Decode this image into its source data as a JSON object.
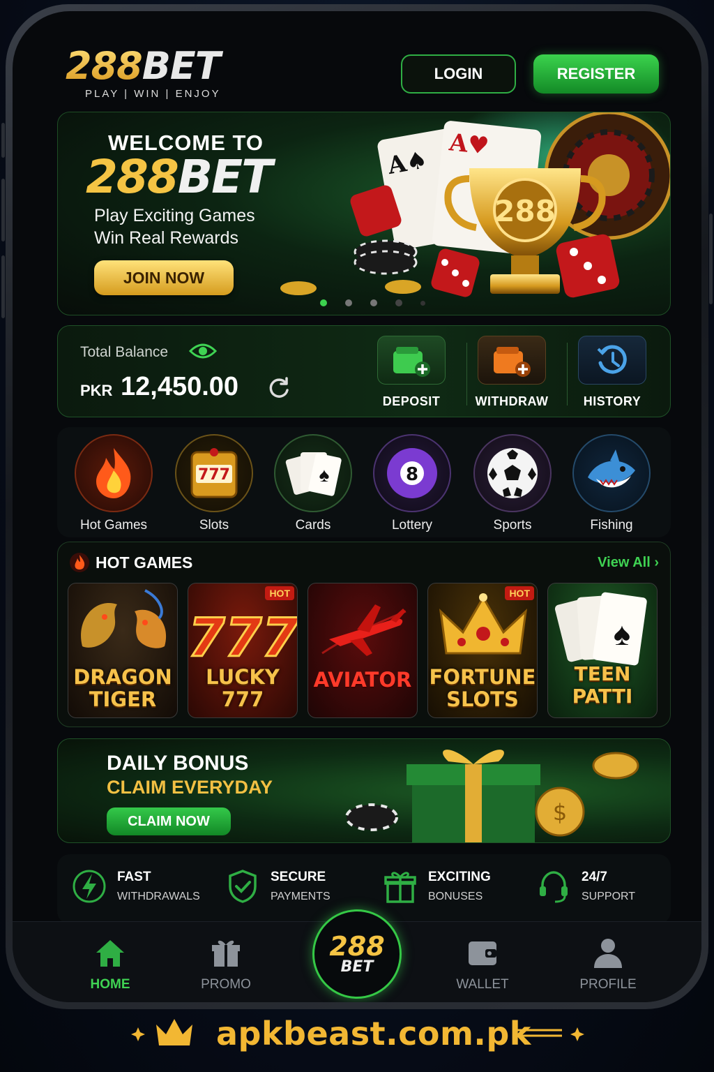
{
  "header": {
    "logo_number": "288",
    "logo_word": "BET",
    "logo_tagline": "PLAY | WIN | ENJOY",
    "login_label": "LOGIN",
    "register_label": "REGISTER"
  },
  "hero": {
    "welcome": "WELCOME TO",
    "brand_number": "288",
    "brand_word": "BET",
    "line1": "Play Exciting Games",
    "line2": "Win Real Rewards",
    "cta": "JOIN NOW",
    "trophy_text": "288",
    "carousel": {
      "count": 5,
      "active": 1
    }
  },
  "balance": {
    "label": "Total Balance",
    "currency": "PKR",
    "amount": "12,450.00",
    "actions": [
      {
        "label": "DEPOSIT",
        "icon": "wallet-plus-icon"
      },
      {
        "label": "WITHDRAW",
        "icon": "wallet-minus-icon"
      },
      {
        "label": "HISTORY",
        "icon": "history-icon"
      }
    ]
  },
  "categories": [
    {
      "label": "Hot Games",
      "icon": "flame-icon"
    },
    {
      "label": "Slots",
      "icon": "slot-machine-icon"
    },
    {
      "label": "Cards",
      "icon": "playing-cards-icon"
    },
    {
      "label": "Lottery",
      "icon": "eight-ball-icon"
    },
    {
      "label": "Sports",
      "icon": "soccer-ball-icon"
    },
    {
      "label": "Fishing",
      "icon": "shark-icon"
    }
  ],
  "hot_games": {
    "title": "HOT GAMES",
    "view_all": "View All",
    "games": [
      {
        "line1": "DRAGON",
        "line2": "TIGER",
        "badge": ""
      },
      {
        "line1": "LUCKY",
        "line2": "777",
        "badge": "HOT"
      },
      {
        "line1": "AVIATOR",
        "line2": "",
        "badge": ""
      },
      {
        "line1": "FORTUNE",
        "line2": "SLOTS",
        "badge": "HOT"
      },
      {
        "line1": "TEEN PATTI",
        "line2": "",
        "badge": ""
      }
    ]
  },
  "bonus": {
    "title": "DAILY BONUS",
    "subtitle": "CLAIM EVERYDAY",
    "cta": "CLAIM NOW"
  },
  "features": [
    {
      "t1": "FAST",
      "t2": "WITHDRAWALS",
      "icon": "lightning-icon"
    },
    {
      "t1": "SECURE",
      "t2": "PAYMENTS",
      "icon": "shield-check-icon"
    },
    {
      "t1": "EXCITING",
      "t2": "BONUSES",
      "icon": "gift-icon"
    },
    {
      "t1": "24/7",
      "t2": "SUPPORT",
      "icon": "headset-icon"
    }
  ],
  "nav": {
    "items": [
      {
        "label": "HOME",
        "icon": "home-icon",
        "active": true
      },
      {
        "label": "PROMO",
        "icon": "gift-icon",
        "active": false
      },
      {
        "label": "WALLET",
        "icon": "wallet-icon",
        "active": false
      },
      {
        "label": "PROFILE",
        "icon": "user-icon",
        "active": false
      }
    ],
    "center_number": "288",
    "center_word": "BET"
  },
  "footer": {
    "url": "apkbeast.com.pk"
  },
  "colors": {
    "accent_green": "#3fd353",
    "gold": "#f2b733",
    "background": "#07090c"
  }
}
